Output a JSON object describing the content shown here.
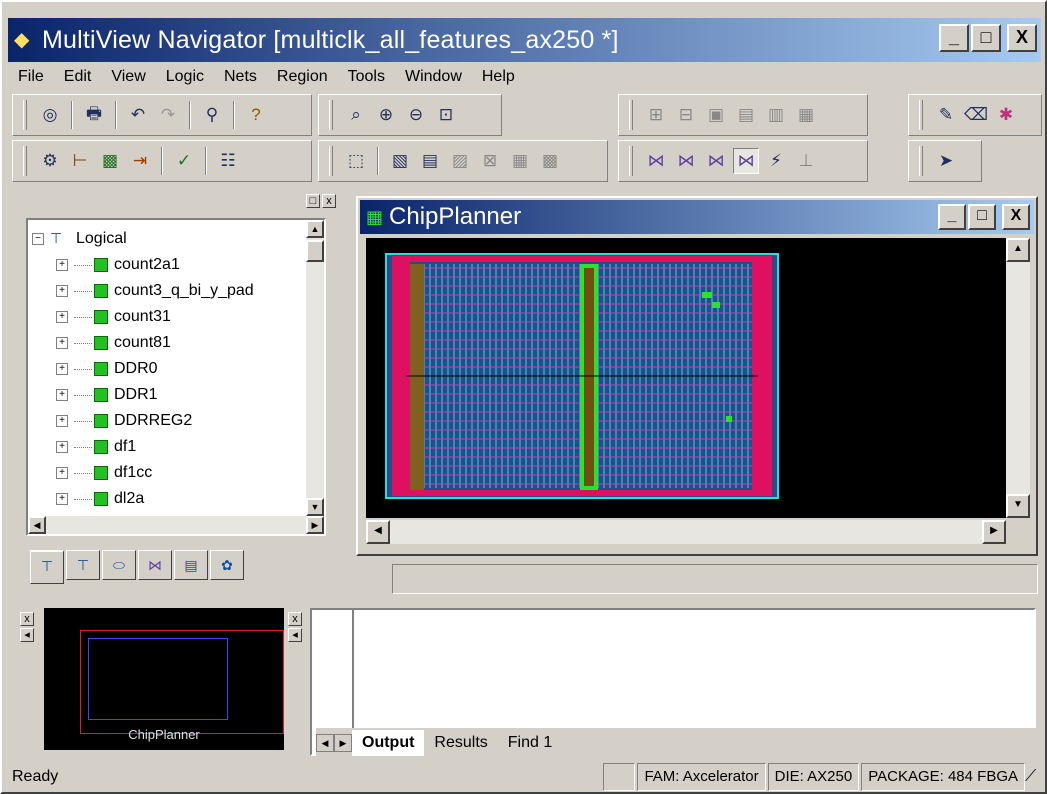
{
  "app": {
    "title": "MultiView Navigator [multiclk_all_features_ax250 *]",
    "min": "_",
    "max": "□",
    "close": "X"
  },
  "menu": [
    "File",
    "Edit",
    "View",
    "Logic",
    "Nets",
    "Region",
    "Tools",
    "Window",
    "Help"
  ],
  "tree": {
    "root": "Logical",
    "items": [
      "count2a1",
      "count3_q_bi_y_pad",
      "count31",
      "count81",
      "DDR0",
      "DDR1",
      "DDRREG2",
      "df1",
      "df1cc",
      "dl2a"
    ]
  },
  "chipplanner": {
    "title": "ChipPlanner",
    "colors": {
      "bg": "#000000",
      "die": "#2a4a8a",
      "cells": "#22e0e0",
      "grid": "#c040c0",
      "io": "#e01060",
      "block": "#30e030"
    }
  },
  "nav": {
    "label": "ChipPlanner"
  },
  "output": {
    "tabs": [
      "Output",
      "Results",
      "Find 1"
    ]
  },
  "status": {
    "ready": "Ready",
    "fam": "FAM: Axcelerator",
    "die": "DIE: AX250",
    "package": "PACKAGE: 484 FBGA"
  }
}
